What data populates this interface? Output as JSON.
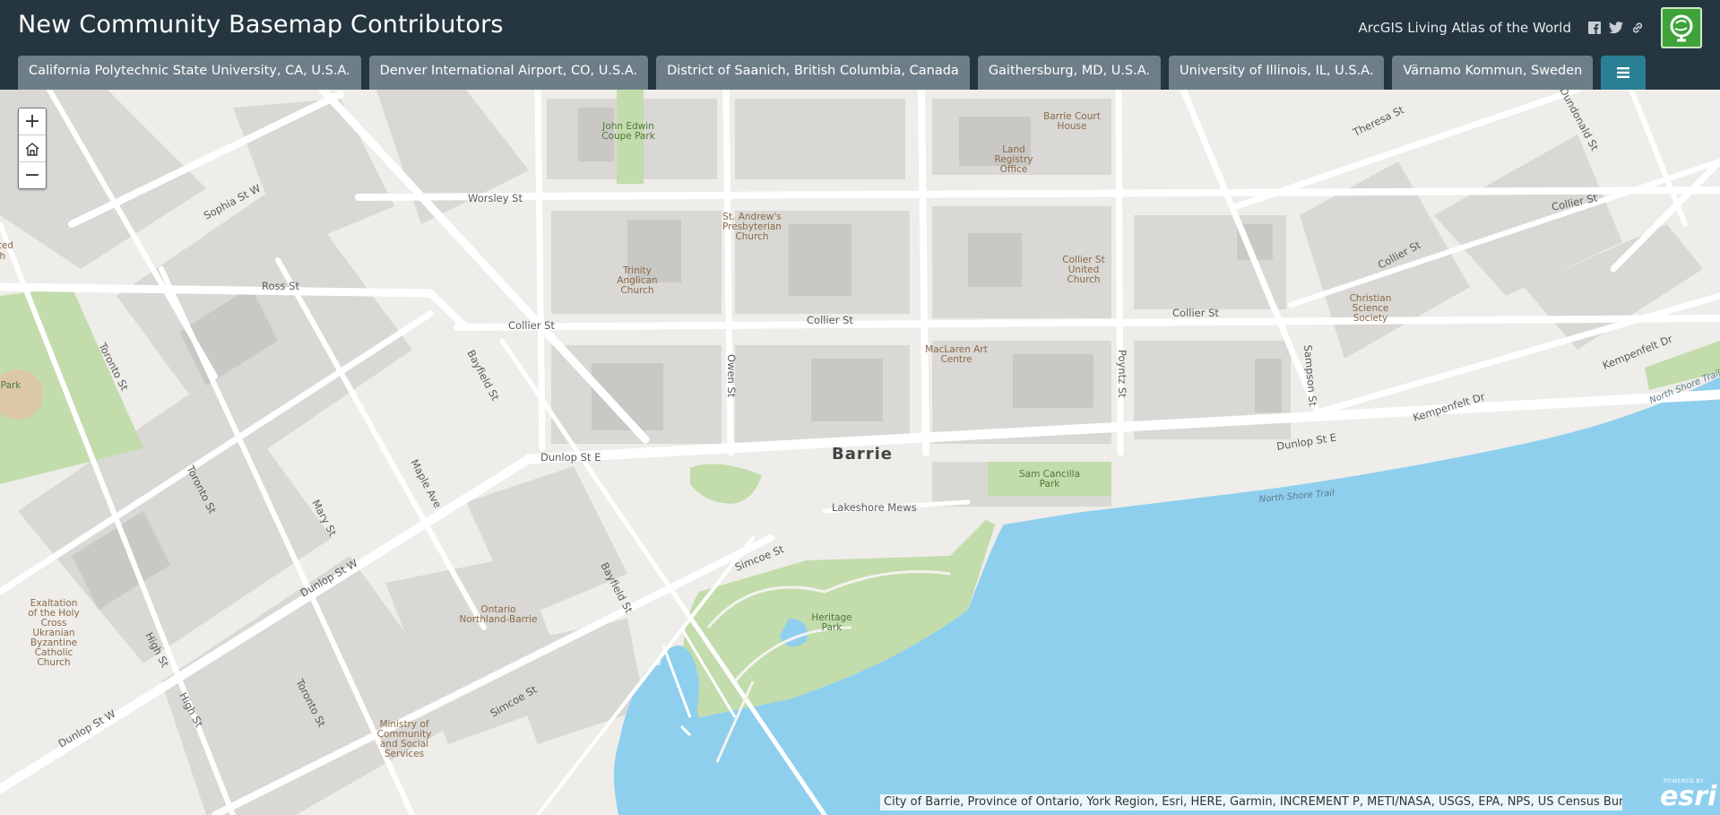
{
  "header": {
    "title": "New Community Basemap Contributors",
    "living_atlas": "ArcGIS Living Atlas of the World",
    "icons": [
      "facebook-icon",
      "twitter-icon",
      "link-icon",
      "living-atlas-logo"
    ]
  },
  "tabs": [
    {
      "label": "California Polytechnic State University, CA, U.S.A."
    },
    {
      "label": "Denver International Airport, CO, U.S.A."
    },
    {
      "label": "District of Saanich, British Columbia, Canada"
    },
    {
      "label": "Gaithersburg, MD, U.S.A."
    },
    {
      "label": "University of Illinois, IL, U.S.A."
    },
    {
      "label": "Värnamo Kommun, Sweden"
    }
  ],
  "map": {
    "city": "Barrie",
    "streets": [
      "Sophia St W",
      "Worsley St",
      "Ross St",
      "Collier St",
      "Collier St",
      "Collier St",
      "Collier St",
      "Collier St",
      "Toronto St",
      "Toronto St",
      "Toronto St",
      "Bayfield St",
      "Bayfield St",
      "Owen St",
      "Maple Ave",
      "Mary St",
      "Dunlop St E",
      "Dunlop St E",
      "Dunlop St W",
      "Dunlop St W",
      "Simcoe St",
      "Simcoe St",
      "High St",
      "High St",
      "Poyntz St",
      "Sampson St",
      "Theresa St",
      "Dundonald St",
      "Kempenfelt Dr",
      "Kempenfelt Dr",
      "Lakeshore Mews",
      "North Shore Trail",
      "North Shore Trail"
    ],
    "pois": [
      "John Edwin Coupe Park",
      "Barrie Court House",
      "Land Registry Office",
      "St. Andrew's Presbyterian Church",
      "Trinity Anglican Church",
      "Collier St United Church",
      "Christian Science Society",
      "MacLaren Art Centre",
      "Sam Cancilla Park",
      "Heritage Park",
      "Ontario Northland-Barrie",
      "Exaltation of the Holy Cross Ukranian Byzantine Catholic Church",
      "Ministry of Community and Social Services",
      "Park"
    ],
    "partial_labels": [
      "Jnited",
      "ch"
    ],
    "colors": {
      "land": "#eeede9",
      "water": "#8fcfee",
      "park": "#b9d6a4",
      "building": "#d6d5d1",
      "road": "#ffffff"
    }
  },
  "zoom": {
    "in": "+",
    "home": "⌂",
    "out": "−"
  },
  "attribution": "City of Barrie, Province of Ontario, York Region, Esri, HERE, Garmin, INCREMENT P, METI/NASA, USGS, EPA, NPS, US Census Bureau, USDA, N...",
  "esri": {
    "powered_by": "POWERED BY",
    "wordmark": "esri"
  }
}
